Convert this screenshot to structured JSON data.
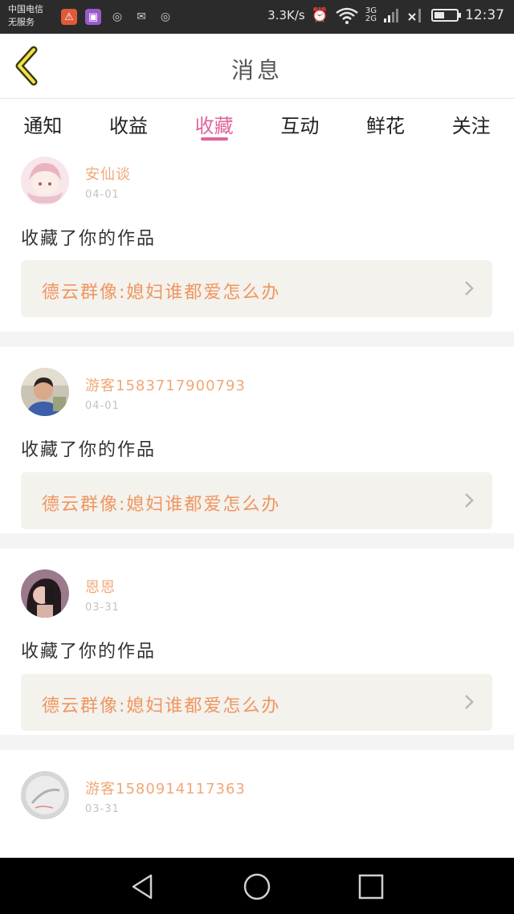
{
  "status_bar": {
    "carrier_line1": "中国电信",
    "carrier_line2": "无服务",
    "net_speed": "3.3K/s",
    "net_type_top": "3G",
    "net_type_bottom": "2G",
    "time": "12:37",
    "battery_level": 0.45
  },
  "header": {
    "title": "消息"
  },
  "tabs": [
    {
      "label": "通知"
    },
    {
      "label": "收益"
    },
    {
      "label": "收藏"
    },
    {
      "label": "互动"
    },
    {
      "label": "鲜花"
    },
    {
      "label": "关注"
    }
  ],
  "active_tab": "收藏",
  "feed": [
    {
      "username": "安仙谈",
      "date": "04-01",
      "action": "收藏了你的作品",
      "work_title": "德云群像:媳妇谁都爱怎么办"
    },
    {
      "username": "游客15837179007​93",
      "date": "04-01",
      "action": "收藏了你的作品",
      "work_title": "德云群像:媳妇谁都爱怎么办"
    },
    {
      "username": "恩恩",
      "date": "03-31",
      "action": "收藏了你的作品",
      "work_title": "德云群像:媳妇谁都爱怎么办"
    },
    {
      "username": "游客15809141173​63",
      "date": "03-31"
    }
  ],
  "colors": {
    "accent": "#e0649a",
    "username": "#f0a878",
    "work_title": "#ef9561",
    "work_bg": "#f4f2ec"
  }
}
